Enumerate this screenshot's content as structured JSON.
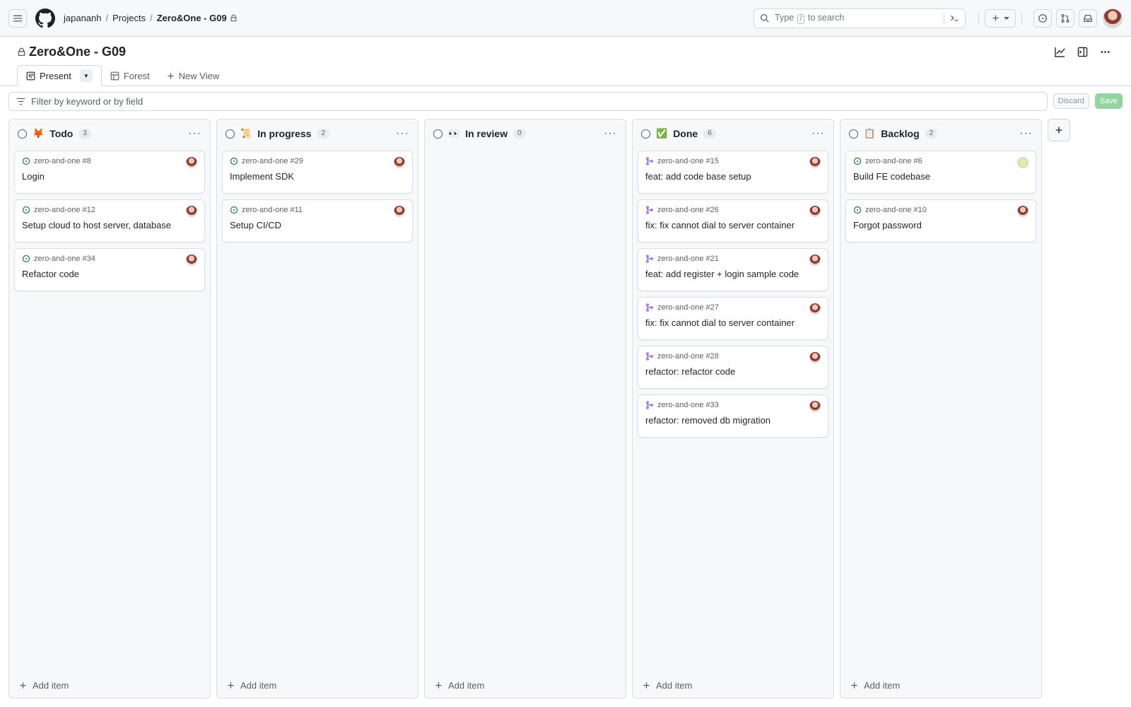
{
  "header": {
    "breadcrumb": {
      "user": "japananh",
      "projects": "Projects",
      "project": "Zero&One - G09"
    },
    "search": {
      "prefix": "Type",
      "key": "/",
      "suffix": "to search"
    }
  },
  "project": {
    "title": "Zero&One - G09",
    "tabs": [
      {
        "label": "Present"
      },
      {
        "label": "Forest"
      },
      {
        "label": "New View"
      }
    ]
  },
  "filter": {
    "placeholder": "Filter by keyword or by field",
    "discard": "Discard",
    "save": "Save"
  },
  "board": {
    "add_item": "Add item",
    "columns": [
      {
        "emoji": "🦊",
        "title": "Todo",
        "count": "3",
        "cards": [
          {
            "type": "issue",
            "ref": "zero-and-one #8",
            "title": "Login",
            "avatar": "a"
          },
          {
            "type": "issue",
            "ref": "zero-and-one #12",
            "title": "Setup cloud to host server, database",
            "avatar": "a"
          },
          {
            "type": "issue",
            "ref": "zero-and-one #34",
            "title": "Refactor code",
            "avatar": "a"
          }
        ]
      },
      {
        "emoji": "📜",
        "title": "In progress",
        "count": "2",
        "cards": [
          {
            "type": "issue",
            "ref": "zero-and-one #29",
            "title": "Implement SDK",
            "avatar": "a"
          },
          {
            "type": "issue",
            "ref": "zero-and-one #11",
            "title": "Setup CI/CD",
            "avatar": "a"
          }
        ]
      },
      {
        "emoji": "👀",
        "title": "In review",
        "count": "0",
        "cards": []
      },
      {
        "emoji": "✅",
        "title": "Done",
        "count": "6",
        "cards": [
          {
            "type": "pr",
            "ref": "zero-and-one #15",
            "title": "feat: add code base setup",
            "avatar": "a"
          },
          {
            "type": "pr",
            "ref": "zero-and-one #26",
            "title": "fix: fix cannot dial to server container",
            "avatar": "a"
          },
          {
            "type": "pr",
            "ref": "zero-and-one #21",
            "title": "feat: add register + login sample code",
            "avatar": "a"
          },
          {
            "type": "pr",
            "ref": "zero-and-one #27",
            "title": "fix: fix cannot dial to server container",
            "avatar": "a"
          },
          {
            "type": "pr",
            "ref": "zero-and-one #28",
            "title": "refactor: refactor code",
            "avatar": "a"
          },
          {
            "type": "pr",
            "ref": "zero-and-one #33",
            "title": "refactor: removed db migration",
            "avatar": "a"
          }
        ]
      },
      {
        "emoji": "📋",
        "title": "Backlog",
        "count": "2",
        "cards": [
          {
            "type": "issue",
            "ref": "zero-and-one #6",
            "title": "Build FE codebase",
            "avatar": "b"
          },
          {
            "type": "issue",
            "ref": "zero-and-one #10",
            "title": "Forgot password",
            "avatar": "a"
          }
        ]
      }
    ]
  },
  "colors": {
    "issue_open": "#1a7f37",
    "pr_merged": "#8250df",
    "save_disabled": "#94d3a2"
  }
}
